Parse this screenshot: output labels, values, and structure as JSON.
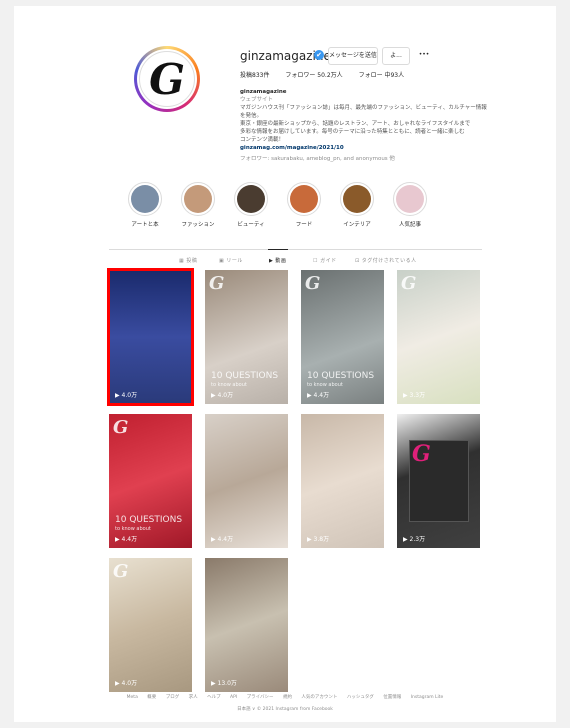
{
  "profile": {
    "username": "ginzamagazine",
    "verified_icon": "✔",
    "follow_button": "メッセージを送信",
    "follow2_button": "よ...",
    "more_button": "•••",
    "stats": [
      "投稿833件",
      "フォロワー 50.2万人",
      "フォロー 中93人"
    ],
    "bio_name": "ginzamagazine",
    "bio_category": "ウェブサイト",
    "bio_lines": [
      "マガジンハウス刊「ファッション誌」は毎月、最先端のファッション、ビューティ、カルチャー情報を発信。",
      "東京・銀座の最新ショップから、話題のレストラン、アート、おしゃれなライフスタイルまで",
      "多彩な情報をお届けしています。毎号のテーマに沿った特集とともに、読者と一緒に楽しむ",
      "コンテンツ満載！"
    ],
    "bio_link": "ginzamag.com/magazine/2021/10",
    "bio_follow": "フォロワー: sakurabaku, ameblog_pn, and anonymous 他"
  },
  "highlights": [
    {
      "label": "アートと本",
      "color": "#7a8ea6"
    },
    {
      "label": "ファッション",
      "color": "#c49a7a"
    },
    {
      "label": "ビューティ",
      "color": "#4a3c30"
    },
    {
      "label": "フード",
      "color": "#c86a3a"
    },
    {
      "label": "インテリア",
      "color": "#8a5a2a"
    },
    {
      "label": "人気記事",
      "color": "#e8c8d0"
    }
  ],
  "tabs": [
    {
      "label": "▦ 投稿",
      "active": false
    },
    {
      "label": "▣ リール",
      "active": false
    },
    {
      "label": "▶ 動画",
      "active": true
    },
    {
      "label": "☐ ガイド",
      "active": false
    },
    {
      "label": "⊡ タグ付けされている人",
      "active": false
    }
  ],
  "tiles": [
    {
      "views": "▶ 4.0万",
      "caption": "",
      "sub": "",
      "bg": "linear-gradient(180deg,#1a2a6c 0%,#3a4ca0 50%,#2a3a7a 100%)",
      "g": false
    },
    {
      "views": "▶ 4.0万",
      "caption": "10 QUESTIONS",
      "sub": "to know about",
      "bg": "linear-gradient(160deg,#9a8a7a 0%,#d8d0c8 60%,#b8b0a8 100%)",
      "g": true
    },
    {
      "views": "▶ 4.4万",
      "caption": "10 QUESTIONS",
      "sub": "to know about",
      "bg": "linear-gradient(160deg,#6a7070 0%,#a8b0b0 60%,#7a8080 100%)",
      "g": true
    },
    {
      "views": "▶ 3.3万",
      "caption": "",
      "sub": "",
      "bg": "linear-gradient(160deg,#c8d0c8 0%,#f0ece4 50%,#d8e0c0 100%)",
      "g": true
    },
    {
      "views": "▶ 4.4万",
      "caption": "10 QUESTIONS",
      "sub": "to know about",
      "bg": "linear-gradient(160deg,#c02030 0%,#e04050 50%,#a01828 100%)",
      "g": true
    },
    {
      "views": "▶ 4.4万",
      "caption": "",
      "sub": "",
      "bg": "linear-gradient(160deg,#d8d0c8 0%,#b8a898 50%,#e8e0d8 100%)",
      "g": false
    },
    {
      "views": "▶ 3.8万",
      "caption": "",
      "sub": "",
      "bg": "linear-gradient(160deg,#c8b8a8 0%,#e8dcd0 50%,#d0c4b8 100%)",
      "g": false
    },
    {
      "views": "▶ 2.3万",
      "caption": "",
      "sub": "",
      "bg": "linear-gradient(160deg,#f0f0f0 0%,#303030 40%,#404040 100%)",
      "g": false
    },
    {
      "views": "▶ 4.0万",
      "caption": "",
      "sub": "",
      "bg": "linear-gradient(160deg,#e8e0d0 0%,#c8b8a0 50%,#a89880 100%)",
      "g": true
    },
    {
      "views": "▶ 13.0万",
      "caption": "",
      "sub": "",
      "bg": "linear-gradient(160deg,#8a7a6a 0%,#c8c0b0 50%,#9a8a7a 100%)",
      "g": false
    }
  ],
  "footer": {
    "links": [
      "Meta",
      "概要",
      "ブログ",
      "求人",
      "ヘルプ",
      "API",
      "プライバシー",
      "規約",
      "人気のアカウント",
      "ハッシュタグ",
      "位置情報",
      "Instagram Lite"
    ],
    "copyright": "日本語 ∨   © 2021 Instagram from Facebook"
  }
}
